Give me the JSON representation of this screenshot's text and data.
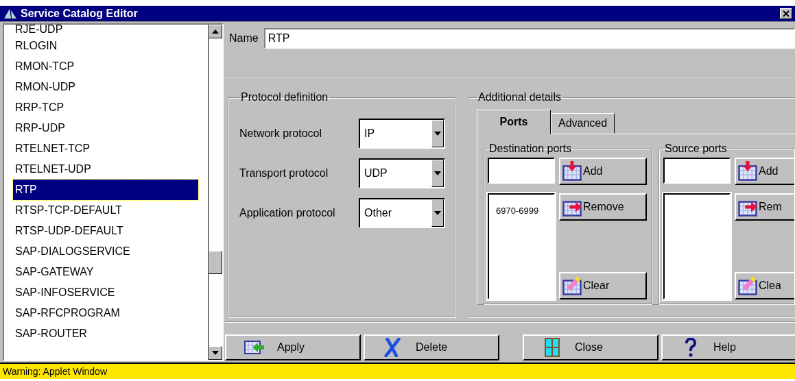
{
  "window": {
    "title": "Service Catalog Editor"
  },
  "services": [
    {
      "label": "RJE-UDP",
      "selected": false
    },
    {
      "label": "RLOGIN",
      "selected": false
    },
    {
      "label": "RMON-TCP",
      "selected": false
    },
    {
      "label": "RMON-UDP",
      "selected": false
    },
    {
      "label": "RRP-TCP",
      "selected": false
    },
    {
      "label": "RRP-UDP",
      "selected": false
    },
    {
      "label": "RTELNET-TCP",
      "selected": false
    },
    {
      "label": "RTELNET-UDP",
      "selected": false
    },
    {
      "label": "RTP",
      "selected": true
    },
    {
      "label": "RTSP-TCP-DEFAULT",
      "selected": false
    },
    {
      "label": "RTSP-UDP-DEFAULT",
      "selected": false
    },
    {
      "label": "SAP-DIALOGSERVICE",
      "selected": false
    },
    {
      "label": "SAP-GATEWAY",
      "selected": false
    },
    {
      "label": "SAP-INFOSERVICE",
      "selected": false
    },
    {
      "label": "SAP-RFCPROGRAM",
      "selected": false
    },
    {
      "label": "SAP-ROUTER",
      "selected": false
    }
  ],
  "name": {
    "label": "Name",
    "value": "RTP"
  },
  "protocol_definition": {
    "title": "Protocol definition",
    "fields": [
      {
        "label": "Network protocol",
        "value": "IP"
      },
      {
        "label": "Transport protocol",
        "value": "UDP"
      },
      {
        "label": "Application protocol",
        "value": "Other"
      }
    ]
  },
  "additional_details": {
    "title": "Additional details",
    "tabs": [
      {
        "label": "Ports",
        "selected": true
      },
      {
        "label": "Advanced",
        "selected": false
      }
    ],
    "port_groups": [
      {
        "title": "Destination ports",
        "entries": [
          "6970-6999"
        ],
        "buttons": [
          {
            "label": "Add",
            "kind": "add"
          },
          {
            "label": "Remove",
            "kind": "remove"
          },
          {
            "label": "Clear",
            "kind": "clear"
          }
        ]
      },
      {
        "title": "Source ports",
        "buttons": [
          {
            "label": "Add",
            "kind": "add"
          },
          {
            "label": "Rem",
            "kind": "remove"
          },
          {
            "label": "Clea",
            "kind": "clear"
          }
        ]
      }
    ]
  },
  "actions": [
    {
      "label": "Apply",
      "kind": "apply"
    },
    {
      "label": "Delete",
      "kind": "delete"
    },
    {
      "label": "Close",
      "kind": "close"
    },
    {
      "label": "Help",
      "kind": "help"
    }
  ],
  "status_bar": "Warning: Applet Window"
}
